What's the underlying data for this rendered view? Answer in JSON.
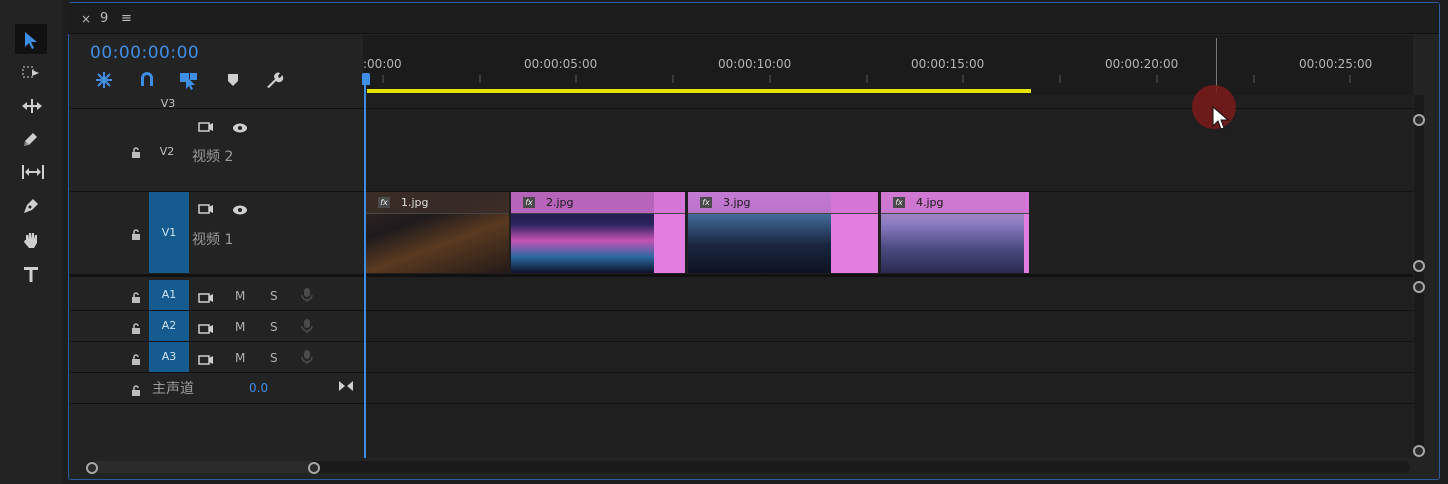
{
  "panel": {
    "close_label": "×",
    "sequence_name": "9",
    "menu_glyph": "≡"
  },
  "timecode": "00:00:00:00",
  "ruler": {
    "labels": [
      ":00:00",
      "00:00:05:00",
      "00:00:10:00",
      "00:00:15:00",
      "00:00:20:00",
      "00:00:25:00"
    ]
  },
  "tools": [
    "selection-tool",
    "track-select-tool",
    "ripple-edit-tool",
    "razor-tool",
    "slip-tool",
    "pen-tool",
    "hand-tool",
    "type-tool"
  ],
  "timeline_tools": [
    "nest-sequence",
    "snap",
    "linked-selection",
    "add-marker",
    "settings"
  ],
  "tracks": {
    "video": [
      {
        "id": "V3",
        "name": ""
      },
      {
        "id": "V2",
        "name": "视频 2"
      },
      {
        "id": "V1",
        "name": "视频 1"
      }
    ],
    "audio": [
      {
        "id": "A1",
        "mute": "M",
        "solo": "S"
      },
      {
        "id": "A2",
        "mute": "M",
        "solo": "S"
      },
      {
        "id": "A3",
        "mute": "M",
        "solo": "S"
      }
    ],
    "master": {
      "name": "主声道",
      "value": "0.0"
    }
  },
  "clips": [
    {
      "name": "1.jpg",
      "fx": "fx"
    },
    {
      "name": "2.jpg",
      "fx": "fx"
    },
    {
      "name": "3.jpg",
      "fx": "fx"
    },
    {
      "name": "4.jpg",
      "fx": "fx"
    }
  ],
  "colors": {
    "accent": "#3f8ee6",
    "work_area": "#e5e400",
    "clip": "#e17ee0",
    "track_target": "#155b8f"
  }
}
